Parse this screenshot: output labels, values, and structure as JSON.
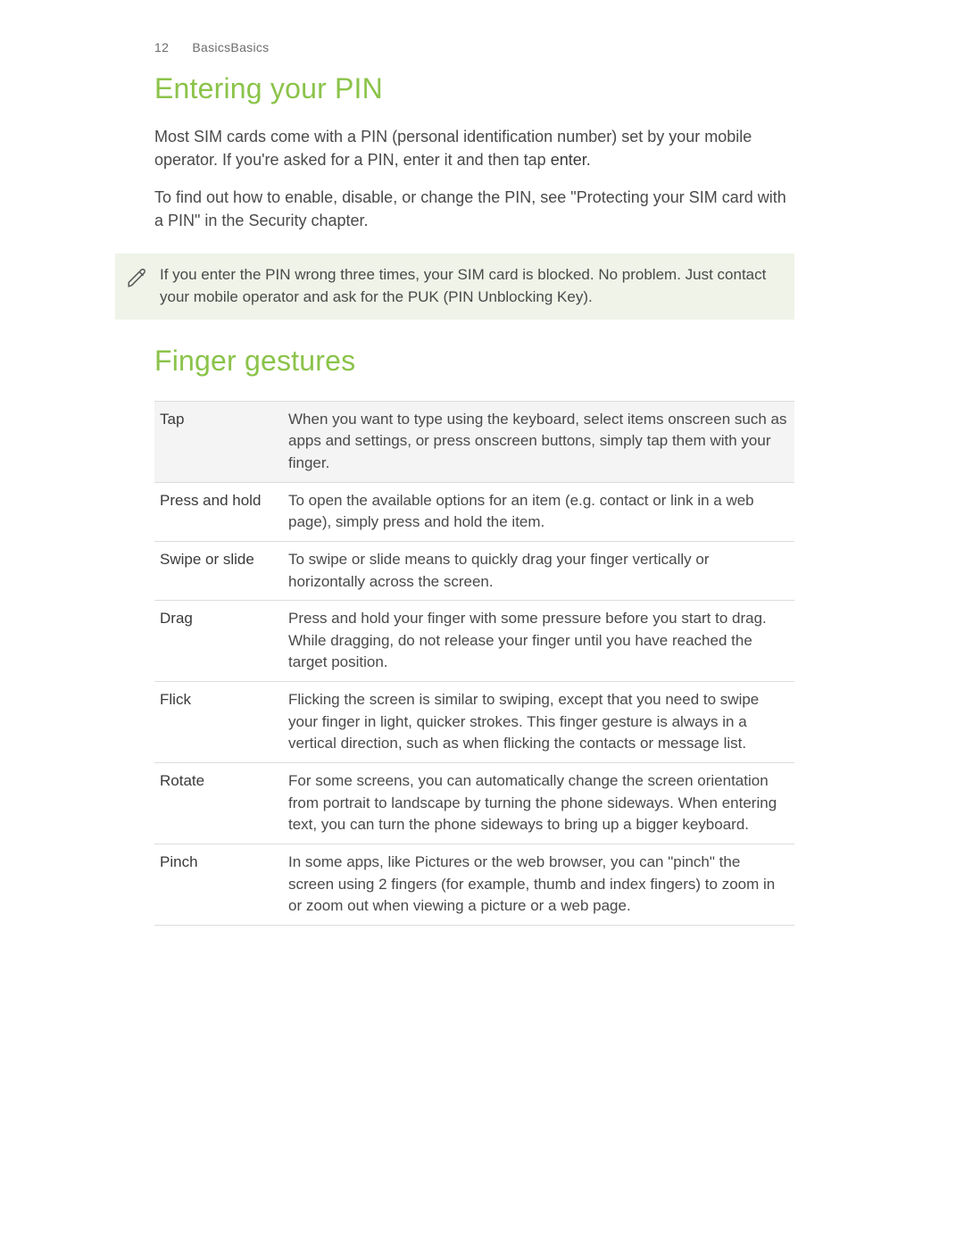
{
  "header": {
    "page_number": "12",
    "breadcrumb": "BasicsBasics"
  },
  "section1": {
    "heading": "Entering your PIN",
    "para1_a": "Most SIM cards come with a PIN (personal identification number) set by your mobile operator. If you're asked for a PIN, enter it and then tap ",
    "para1_enter": "enter",
    "para1_b": ".",
    "para2": "To find out how to enable, disable, or change the PIN, see \"Protecting your SIM card with a PIN\" in the Security chapter."
  },
  "callout": {
    "text": "If you enter the PIN wrong three times, your SIM card is blocked. No problem. Just contact your mobile operator and ask for the PUK (PIN Unblocking Key)."
  },
  "section2": {
    "heading": "Finger gestures"
  },
  "gestures": [
    {
      "term": "Tap",
      "desc": "When you want to type using the keyboard, select items onscreen such as apps and settings, or press onscreen buttons, simply tap them with your finger."
    },
    {
      "term": "Press and hold",
      "desc": "To open the available options for an item (e.g. contact or link in a web page), simply press and hold the item."
    },
    {
      "term": "Swipe or slide",
      "desc": "To swipe or slide means to quickly drag your finger vertically or horizontally across the screen."
    },
    {
      "term": "Drag",
      "desc": "Press and hold your finger with some pressure before you start to drag. While dragging, do not release your finger until you have reached the target position."
    },
    {
      "term": "Flick",
      "desc": "Flicking the screen is similar to swiping, except that you need to swipe your finger in light, quicker strokes. This finger gesture is always in a vertical direction, such as when flicking the contacts or message list."
    },
    {
      "term": "Rotate",
      "desc": "For some screens, you can automatically change the screen orientation from portrait to landscape by turning the phone sideways. When entering text, you can turn the phone sideways to bring up a bigger keyboard."
    },
    {
      "term": "Pinch",
      "desc": "In some apps, like Pictures or the web browser, you can \"pinch\" the screen using 2 fingers (for example, thumb and index fingers) to zoom in or zoom out when viewing a picture or a web page."
    }
  ]
}
